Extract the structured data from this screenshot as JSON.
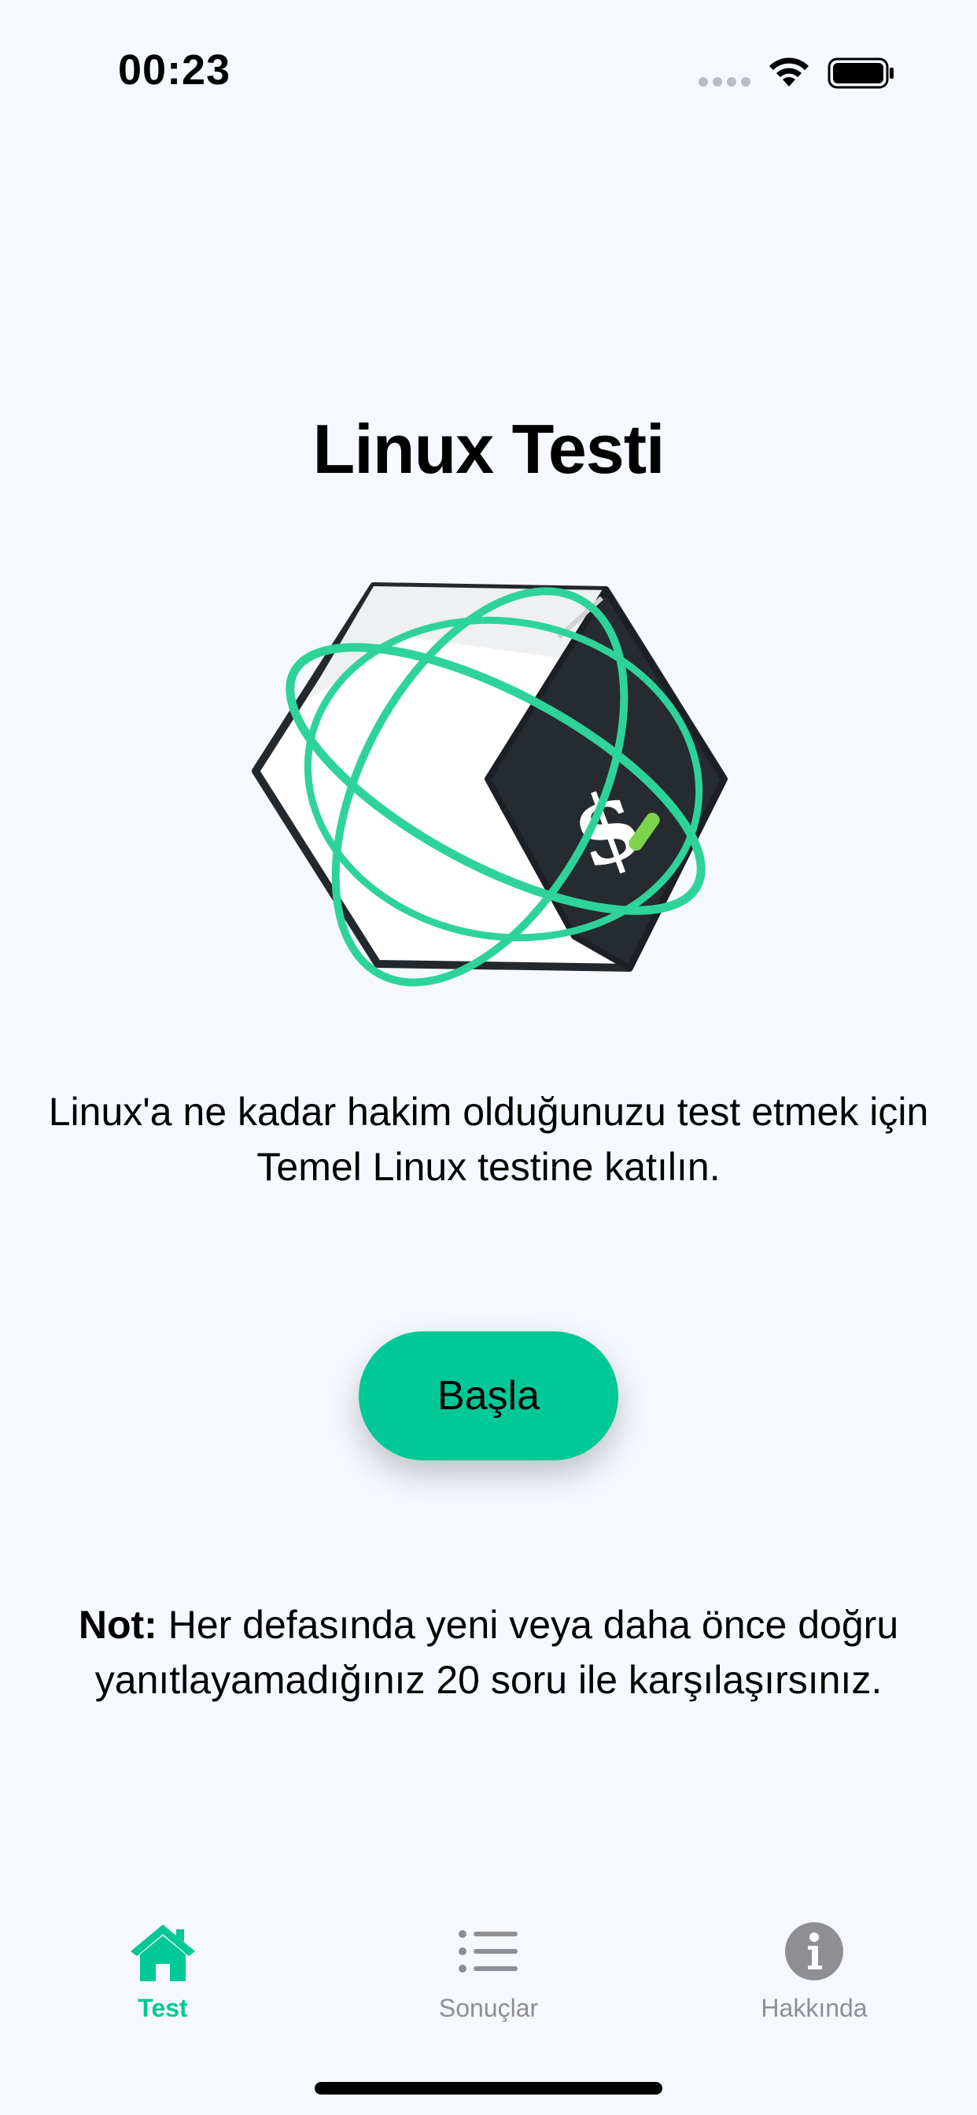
{
  "status_bar": {
    "time": "00:23"
  },
  "main": {
    "title": "Linux Testi",
    "intro": "Linux'a ne kadar hakim olduğunuzu test etmek için Temel Linux testine katılın.",
    "start_label": "Başla",
    "note_prefix": "Not:",
    "note_body": " Her defasında yeni veya daha önce doğru yanıtlayamadığınız 20 soru ile karşılaşırsınız."
  },
  "tabs": [
    {
      "label": "Test",
      "icon": "house-icon",
      "active": true
    },
    {
      "label": "Sonuçlar",
      "icon": "list-icon",
      "active": false
    },
    {
      "label": "Hakkında",
      "icon": "info-icon",
      "active": false
    }
  ],
  "colors": {
    "accent": "#00c896",
    "background": "#f5f8fe",
    "inactive": "#8e8e93"
  }
}
